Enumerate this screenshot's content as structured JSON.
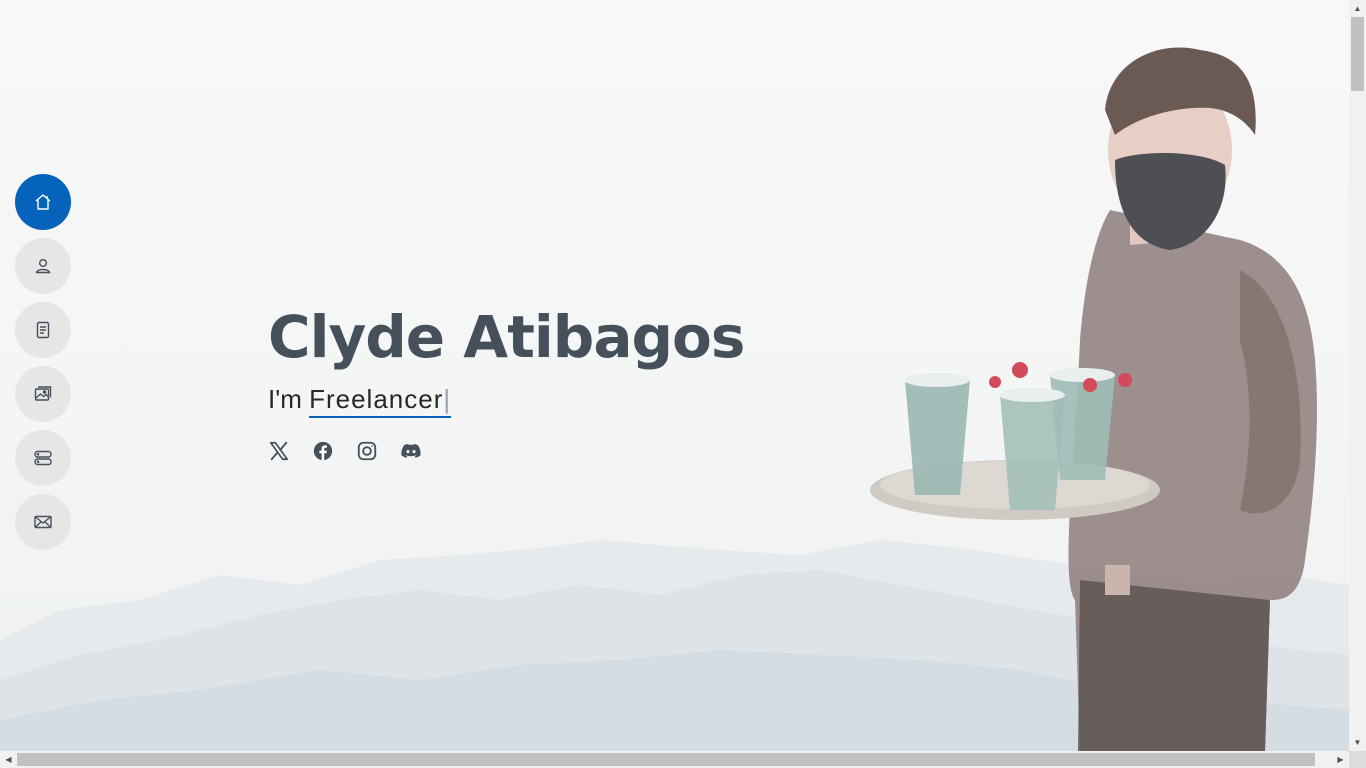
{
  "hero": {
    "name": "Clyde Atibagos",
    "prefix": "I'm ",
    "typed_word": "Freelancer",
    "cursor": "|"
  },
  "nav": {
    "items": [
      {
        "icon": "home-icon",
        "active": true
      },
      {
        "icon": "person-icon",
        "active": false
      },
      {
        "icon": "file-text-icon",
        "active": false
      },
      {
        "icon": "images-icon",
        "active": false
      },
      {
        "icon": "server-icon",
        "active": false
      },
      {
        "icon": "envelope-icon",
        "active": false
      }
    ]
  },
  "socials": [
    {
      "icon": "x-twitter-icon"
    },
    {
      "icon": "facebook-icon"
    },
    {
      "icon": "instagram-icon"
    },
    {
      "icon": "discord-icon"
    }
  ],
  "colors": {
    "accent": "#0563bb",
    "heading": "#45505b",
    "text": "#272829",
    "nav_bg": "#e6e6e6"
  }
}
